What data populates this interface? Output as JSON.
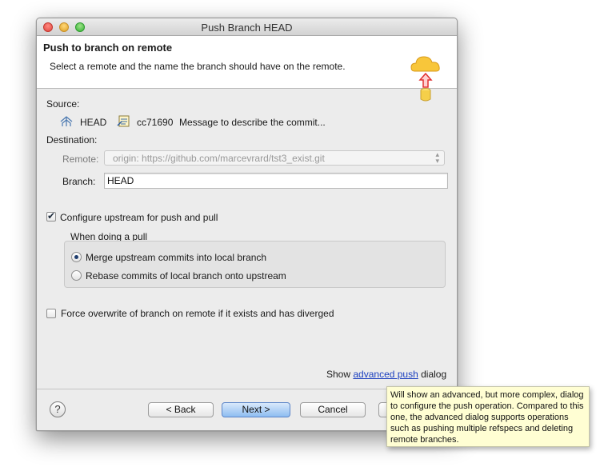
{
  "window": {
    "title": "Push Branch HEAD"
  },
  "banner": {
    "title": "Push to branch on remote",
    "description": "Select a remote and the name the branch should have on the remote.",
    "icon": "cloud-upload-icon"
  },
  "source": {
    "label": "Source:",
    "ref": "HEAD",
    "commit_id": "cc71690",
    "commit_message": "Message to describe the commit..."
  },
  "destination": {
    "label": "Destination:",
    "remote_label": "Remote:",
    "remote_value": "origin: https://github.com/marcevrard/tst3_exist.git",
    "branch_label": "Branch:",
    "branch_value": "HEAD"
  },
  "upstream": {
    "label": "Configure upstream for push and pull",
    "checked": true,
    "group_label": "When doing a pull",
    "options": [
      {
        "label": "Merge upstream commits into local branch",
        "selected": true
      },
      {
        "label": "Rebase commits of local branch onto upstream",
        "selected": false
      }
    ]
  },
  "force": {
    "label": "Force overwrite of branch on remote if it exists and has diverged",
    "checked": false
  },
  "advanced": {
    "prefix": "Show",
    "link": "advanced push",
    "suffix": "dialog"
  },
  "buttons": {
    "back": "< Back",
    "next": "Next >",
    "cancel": "Cancel",
    "finish": ""
  },
  "tooltip": {
    "text": "Will show an advanced, but more complex, dialog to configure the push operation. Compared to this one, the advanced dialog supports operations such as pushing multiple refspecs and deleting remote branches."
  },
  "colors": {
    "link": "#1b3fbf",
    "default_button": "#8ebdf1",
    "tooltip_bg": "#fffed3"
  }
}
